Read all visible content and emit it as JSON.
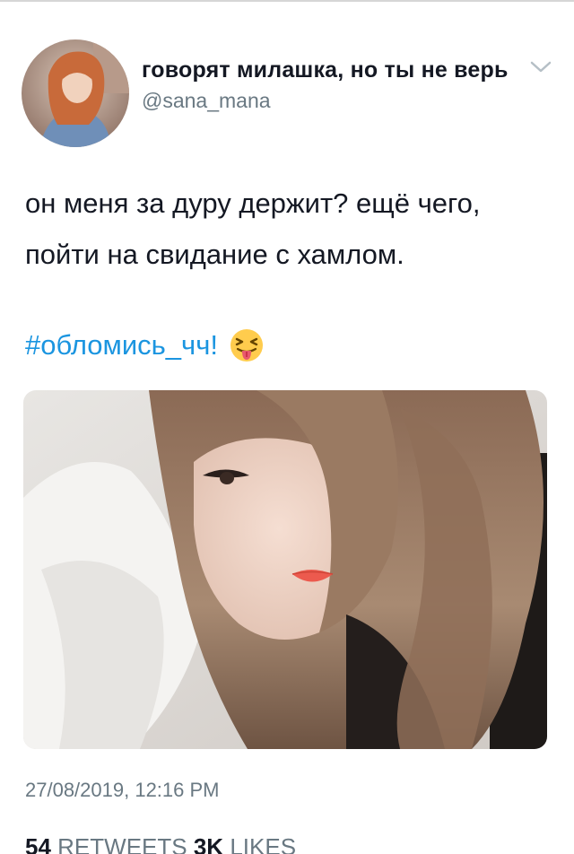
{
  "tweet": {
    "author": {
      "display_name": "говорят милашка, но ты не верь",
      "handle": "@sana_mana"
    },
    "text_lines": [
      "он меня за дуру держит? ещё чего,",
      "пойти на свидание с хамлом."
    ],
    "hashtag": "#обломись_чч!",
    "emoji": "squinting-face-with-tongue",
    "timestamp": "27/08/2019, 12:16 PM",
    "stats": {
      "retweets_count": "54",
      "retweets_label": "RETWEETS",
      "likes_count": "3K",
      "likes_label": "LIKES"
    }
  },
  "colors": {
    "text": "#141823",
    "secondary": "#697882",
    "link": "#1b95e0"
  }
}
